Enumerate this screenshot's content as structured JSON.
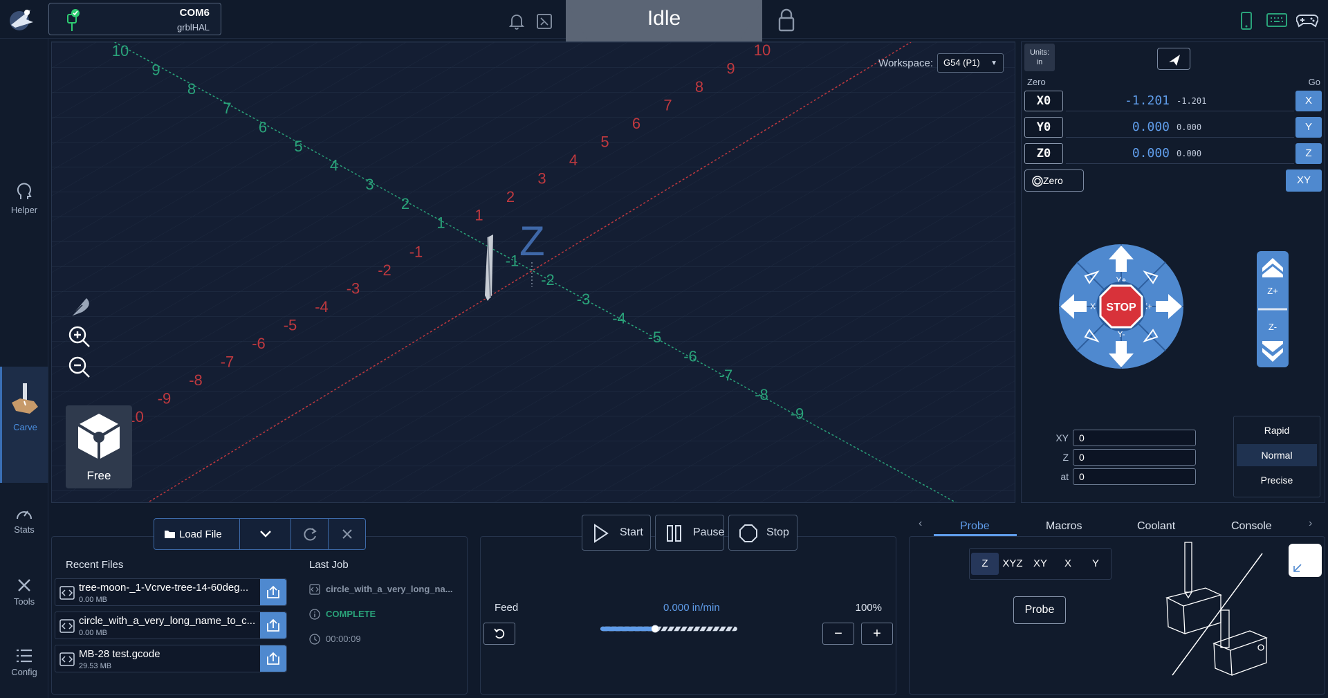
{
  "header": {
    "connection": {
      "port": "COM6",
      "firmware": "grblHAL"
    },
    "status": "Idle"
  },
  "sidebar": {
    "items": [
      {
        "label": "Helper"
      },
      {
        "label": "Carve"
      },
      {
        "label": "Stats"
      },
      {
        "label": "Tools"
      },
      {
        "label": "Config"
      }
    ]
  },
  "viewport": {
    "workspace_label": "Workspace:",
    "workspace_value": "G54 (P1)",
    "camera_mode": "Free",
    "axis_letter": "Z",
    "red_axis_ticks": [
      "10",
      "9",
      "8",
      "7",
      "6",
      "5",
      "4",
      "3",
      "2",
      "1",
      "-1",
      "-2",
      "-3",
      "-4",
      "-5",
      "-6",
      "-7",
      "-8",
      "-9",
      "-10"
    ],
    "green_axis_ticks": [
      "10",
      "9",
      "8",
      "7",
      "6",
      "5",
      "4",
      "3",
      "2",
      "1",
      "-1",
      "-2",
      "-3",
      "-4",
      "-5",
      "-6",
      "-7",
      "-8",
      "-9"
    ]
  },
  "dro": {
    "units_label": "Units:",
    "units_value": "in",
    "zero_label": "Zero",
    "go_label": "Go",
    "axes": [
      {
        "name": "X0",
        "value": "-1.201",
        "machine": "-1.201",
        "go": "X"
      },
      {
        "name": "Y0",
        "value": "0.000",
        "machine": "0.000",
        "go": "Y"
      },
      {
        "name": "Z0",
        "value": "0.000",
        "machine": "0.000",
        "go": "Z"
      }
    ],
    "zero_all": "Zero",
    "go_xy": "XY"
  },
  "jog": {
    "stop": "STOP",
    "labels": {
      "yplus": "Y+",
      "yminus": "Y-",
      "xplus": "X+",
      "xminus": "X-",
      "zplus": "Z+",
      "zminus": "Z-"
    },
    "inputs": [
      {
        "label": "XY",
        "value": "0"
      },
      {
        "label": "Z",
        "value": "0"
      },
      {
        "label": "at",
        "value": "0"
      }
    ],
    "speeds": [
      "Rapid",
      "Normal",
      "Precise"
    ],
    "selected_speed": "Normal"
  },
  "files": {
    "load_label": "Load File",
    "recent_title": "Recent Files",
    "recent": [
      {
        "name": "tree-moon-_1-Vcrve-tree-14-60deg...",
        "size": "0.00 MB"
      },
      {
        "name": "circle_with_a_very_long_name_to_c...",
        "size": "0.00 MB"
      },
      {
        "name": "MB-28 test.gcode",
        "size": "29.53 MB"
      }
    ],
    "last_job_title": "Last Job",
    "last_job": {
      "name": "circle_with_a_very_long_na...",
      "status": "COMPLETE",
      "time": "00:00:09"
    }
  },
  "control": {
    "start": "Start",
    "pause": "Pause",
    "stop": "Stop",
    "feed_label": "Feed",
    "feed_value": "0.000 in/min",
    "feed_percent": "100%",
    "feed_fraction": 0.4
  },
  "tabs": [
    "Probe",
    "Macros",
    "Coolant",
    "Console"
  ],
  "active_tab": "Probe",
  "probe": {
    "axes": [
      "Z",
      "XYZ",
      "XY",
      "X",
      "Y"
    ],
    "selected_axis": "Z",
    "button": "Probe"
  },
  "colors": {
    "accent": "#4f89cf",
    "x_axis": "#c0393f",
    "y_axis": "#2aa37a",
    "stop": "#d8323a"
  }
}
